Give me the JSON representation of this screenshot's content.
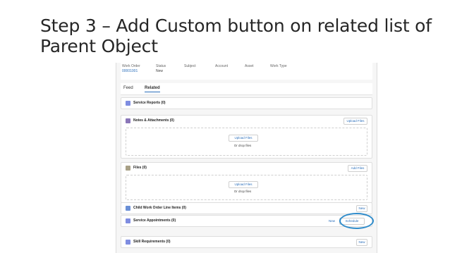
{
  "slide": {
    "title": "Step 3 – Add Custom button on related list of Parent Object"
  },
  "header": {
    "columns": [
      {
        "label": "Work Order",
        "value": "00001001",
        "is_link": true
      },
      {
        "label": "Status",
        "value": "New",
        "is_link": false
      },
      {
        "label": "Subject",
        "value": "",
        "is_link": false
      },
      {
        "label": "Account",
        "value": "",
        "is_link": false
      },
      {
        "label": "Asset",
        "value": "",
        "is_link": false
      },
      {
        "label": "Work Type",
        "value": "",
        "is_link": false
      }
    ]
  },
  "tabs": [
    "Feed",
    "Related"
  ],
  "cards": {
    "service_reports": {
      "title": "Service Reports (0)"
    },
    "notes": {
      "title": "Notes & Attachments (0)",
      "button": "Upload Files",
      "upload": "Upload Files",
      "drop": "Or drop files"
    },
    "files": {
      "title": "Files (0)",
      "button": "Add Files",
      "upload": "Upload Files",
      "drop": "Or drop files"
    },
    "child_wo": {
      "title": "Child Work Order Line Items (0)",
      "button": "New"
    },
    "service_appts": {
      "title": "Service Appointments (0)",
      "new_link": "New",
      "custom_button": "Schedule"
    },
    "skill_req": {
      "title": "Skill Requirements (0)",
      "button": "New"
    }
  },
  "colors": {
    "accent": "#2f8ccb",
    "link": "#2a6ebb"
  }
}
